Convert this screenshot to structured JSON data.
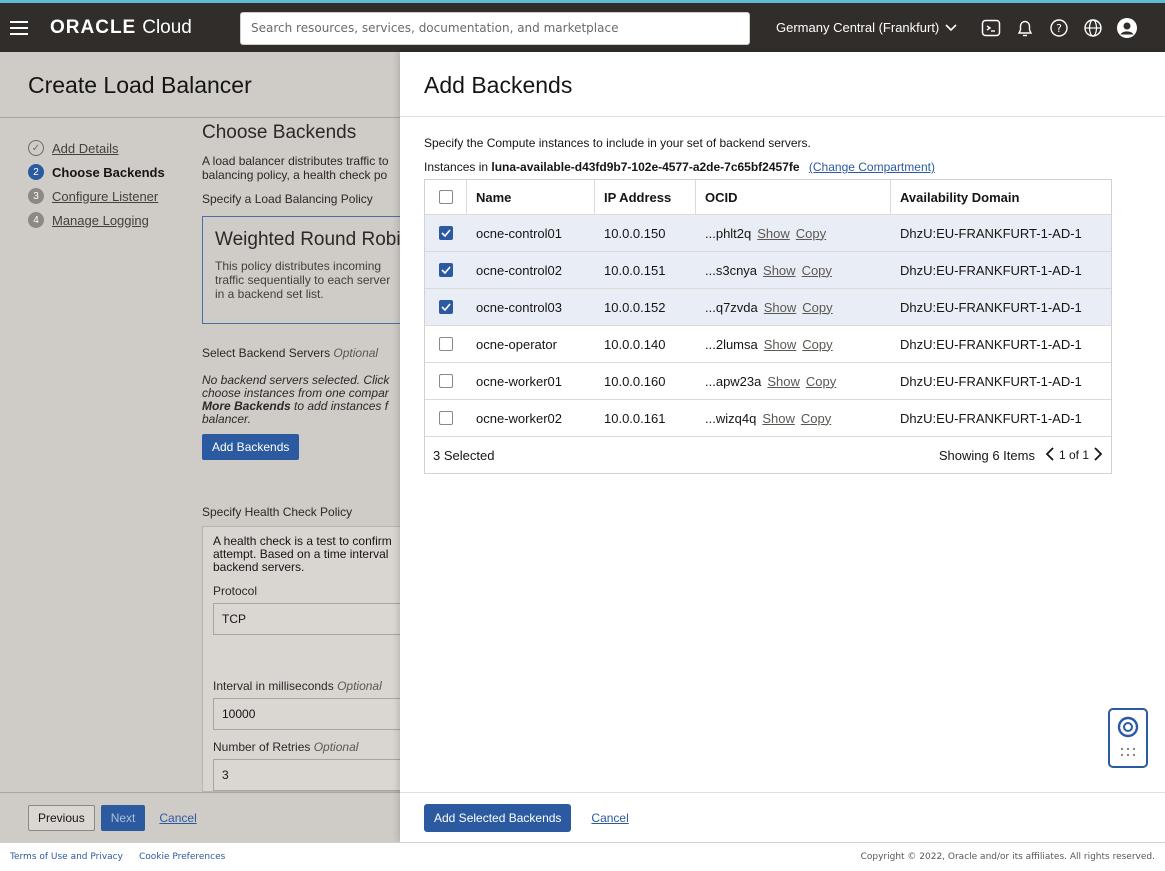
{
  "topbar": {
    "brand_main": "ORACLE",
    "brand_sub": "Cloud",
    "search_placeholder": "Search resources, services, documentation, and marketplace",
    "region": "Germany Central (Frankfurt)",
    "icons": [
      "cloud-shell-icon",
      "bell-icon",
      "help-icon",
      "globe-icon",
      "profile-icon"
    ]
  },
  "page": {
    "title": "Create Load Balancer",
    "steps": [
      {
        "num": "1",
        "label": "Add Details",
        "state": "done"
      },
      {
        "num": "2",
        "label": "Choose Backends",
        "state": "active"
      },
      {
        "num": "3",
        "label": "Configure Listener",
        "state": "todo"
      },
      {
        "num": "4",
        "label": "Manage Logging",
        "state": "todo"
      }
    ],
    "section_title": "Choose Backends",
    "section_desc": "A load balancer distributes traffic to balancing policy, a health check po",
    "policy_label": "Specify a Load Balancing Policy",
    "policy_title": "Weighted Round Robin",
    "policy_desc": "This policy distributes incoming traffic sequentially to each server in a backend set list.",
    "backend_label": "Select Backend Servers",
    "optional": "Optional",
    "backend_desc_1": "No backend servers selected. Click",
    "backend_desc_2": "choose instances from one compar",
    "backend_desc_bold": "More Backends",
    "backend_desc_3": " to add instances f",
    "backend_desc_4": "balancer.",
    "add_backends_btn": "Add Backends",
    "health_label": "Specify Health Check Policy",
    "health_desc": "A health check is a test to confirm attempt. Based on a time interval backend servers.",
    "protocol_label": "Protocol",
    "protocol_value": "TCP",
    "interval_label": "Interval in milliseconds",
    "interval_value": "10000",
    "retries_label": "Number of Retries",
    "retries_value": "3",
    "btn_previous": "Previous",
    "btn_next": "Next",
    "btn_cancel": "Cancel"
  },
  "drawer": {
    "title": "Add Backends",
    "description": "Specify the Compute instances to include in your set of backend servers.",
    "instances_prefix": "Instances in",
    "compartment": "luna-available-d43fd9b7-102e-4577-a2de-7c65bf2457fe",
    "change_compartment": "(Change Compartment)",
    "columns": [
      "Name",
      "IP Address",
      "OCID",
      "Availability Domain"
    ],
    "rows": [
      {
        "name": "ocne-control01",
        "ip": "10.0.0.150",
        "ocid": "...phlt2q",
        "show": "Show",
        "copy": "Copy",
        "ad": "DhzU:EU-FRANKFURT-1-AD-1",
        "selected": true
      },
      {
        "name": "ocne-control02",
        "ip": "10.0.0.151",
        "ocid": "...s3cnya",
        "show": "Show",
        "copy": "Copy",
        "ad": "DhzU:EU-FRANKFURT-1-AD-1",
        "selected": true
      },
      {
        "name": "ocne-control03",
        "ip": "10.0.0.152",
        "ocid": "...q7zvda",
        "show": "Show",
        "copy": "Copy",
        "ad": "DhzU:EU-FRANKFURT-1-AD-1",
        "selected": true
      },
      {
        "name": "ocne-operator",
        "ip": "10.0.0.140",
        "ocid": "...2lumsa",
        "show": "Show",
        "copy": "Copy",
        "ad": "DhzU:EU-FRANKFURT-1-AD-1",
        "selected": false
      },
      {
        "name": "ocne-worker01",
        "ip": "10.0.0.160",
        "ocid": "...apw23a",
        "show": "Show",
        "copy": "Copy",
        "ad": "DhzU:EU-FRANKFURT-1-AD-1",
        "selected": false
      },
      {
        "name": "ocne-worker02",
        "ip": "10.0.0.161",
        "ocid": "...wizq4q",
        "show": "Show",
        "copy": "Copy",
        "ad": "DhzU:EU-FRANKFURT-1-AD-1",
        "selected": false
      }
    ],
    "selected_count": "3 Selected",
    "showing": "Showing 6 Items",
    "page_of": "1 of 1",
    "btn_add_selected": "Add Selected Backends",
    "btn_cancel": "Cancel"
  },
  "footer": {
    "terms": "Terms of Use and Privacy",
    "cookies": "Cookie Preferences",
    "copyright": "Copyright © 2022, Oracle and/or its affiliates. All rights reserved."
  },
  "colors": {
    "topbar_bg": "#312d2a",
    "accent": "#2c5aa0",
    "overlay_bg": "#cfcbc6",
    "selected_row": "#e9eef6"
  }
}
